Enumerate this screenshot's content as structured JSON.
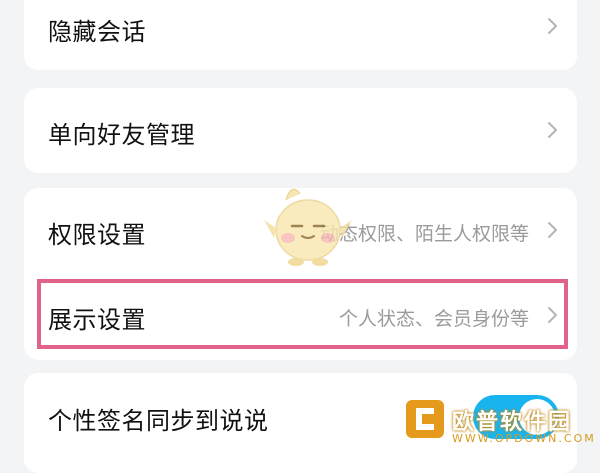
{
  "settings": {
    "hidden_chat": {
      "label": "隐藏会话"
    },
    "one_way_friends": {
      "label": "单向好友管理"
    },
    "permission": {
      "label": "权限设置",
      "desc": "动态权限、陌生人权限等"
    },
    "display": {
      "label": "展示设置",
      "desc": "个人状态、会员身份等"
    },
    "signature_sync": {
      "label": "个性签名同步到说说",
      "toggle_on": true
    }
  },
  "colors": {
    "highlight": "#e2638a",
    "toggle_on": "#17b4f0"
  },
  "icons": {
    "chevron": "chevron-right-icon",
    "mascot": "mascot-watermark-icon",
    "watermark_logo": "watermark-logo-icon"
  },
  "watermark": {
    "text": "欧普软件园",
    "sub": "WWW.OPDOWN.COM"
  }
}
